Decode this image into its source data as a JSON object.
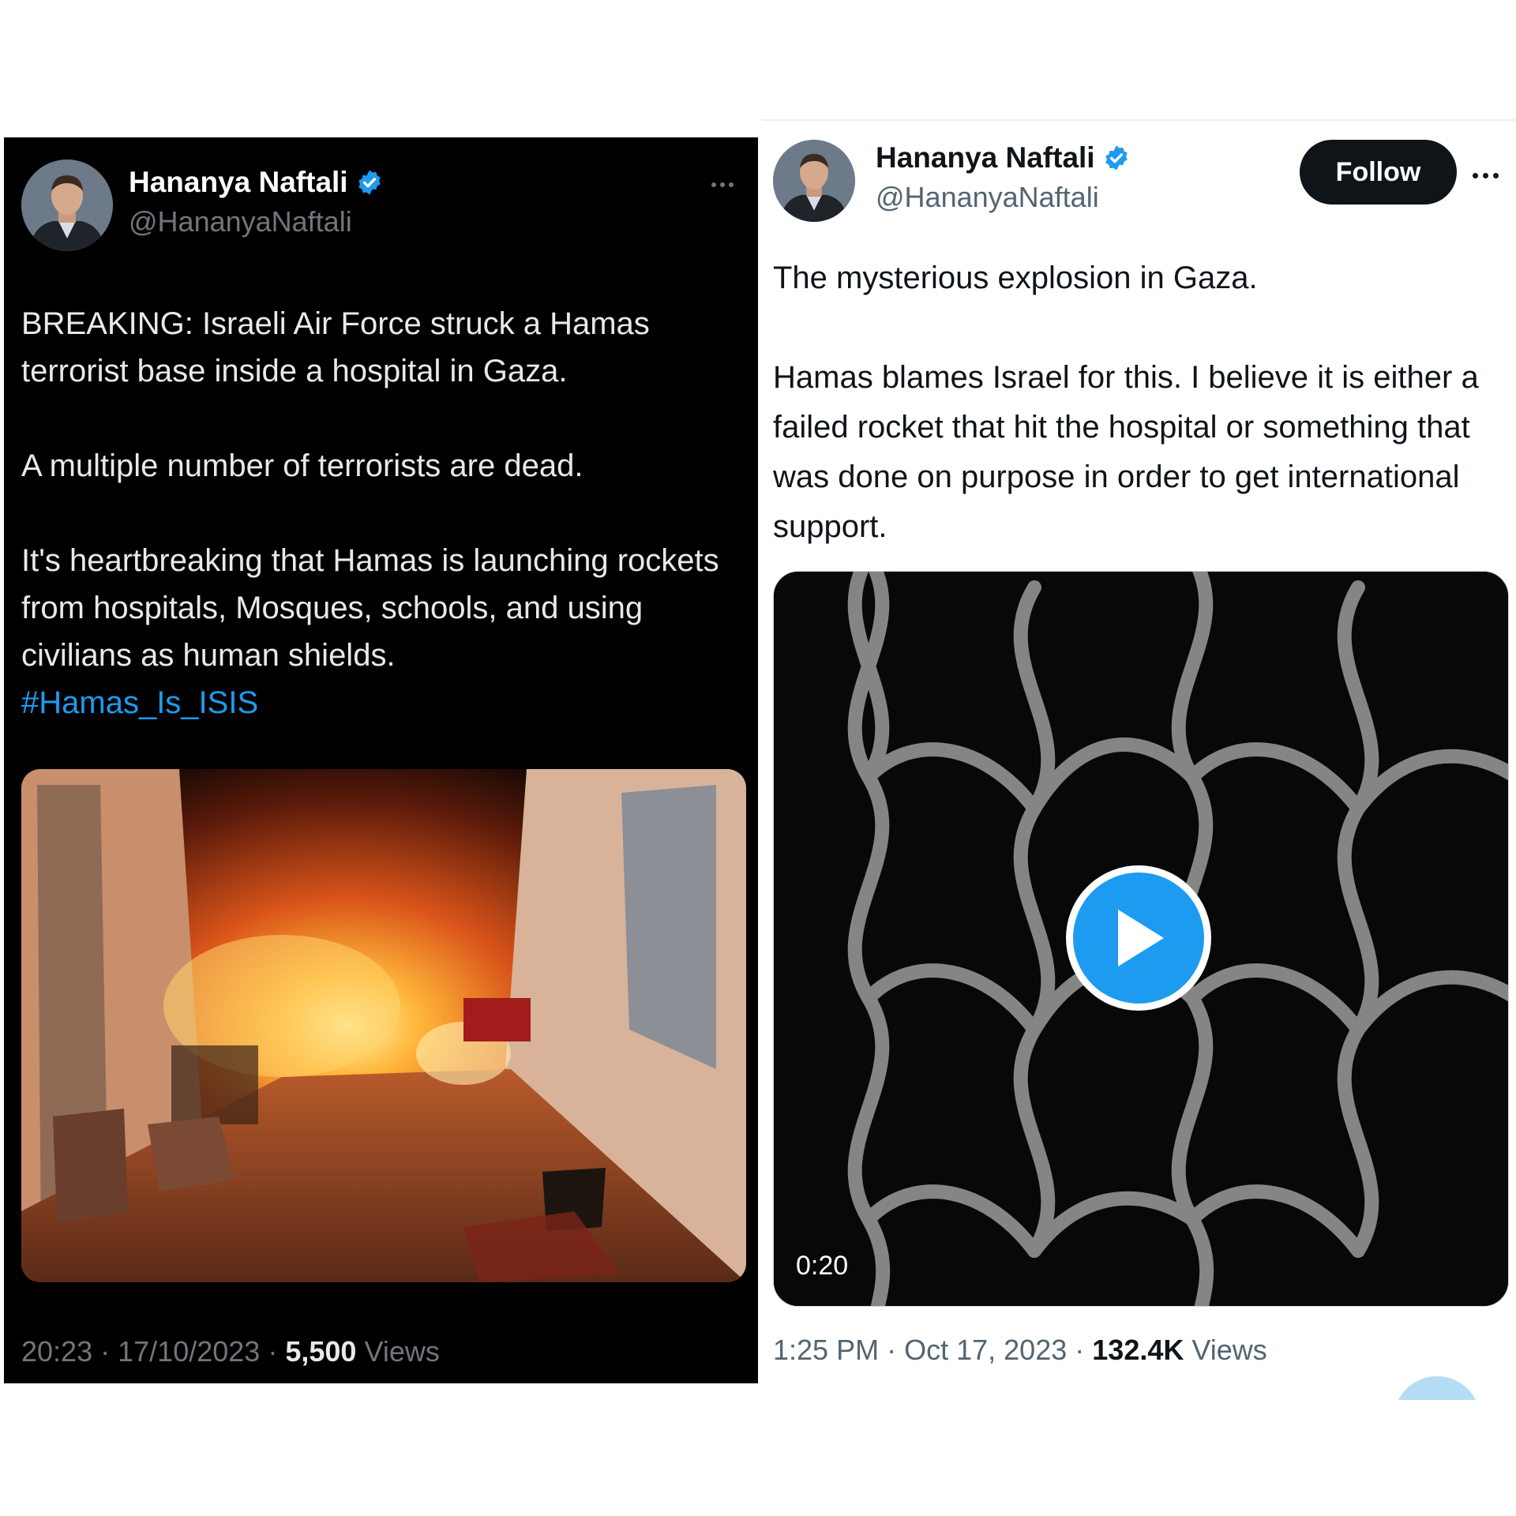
{
  "left_tweet": {
    "theme": "dark",
    "author": {
      "name": "Hananya Naftali",
      "handle": "@HananyaNaftali",
      "verified": true
    },
    "paragraphs": [
      "BREAKING: Israeli Air Force struck a Hamas terrorist base inside a hospital in Gaza.",
      "A multiple number of terrorists are dead.",
      "It's heartbreaking that Hamas is launching rockets from hospitals, Mosques, schools, and using civilians as human shields."
    ],
    "hashtag": "#Hamas_Is_ISIS",
    "media": {
      "kind": "image"
    },
    "meta": {
      "time": "20:23",
      "date": "17/10/2023",
      "views_count": "5,500",
      "views_label": "Views",
      "separator": "·"
    },
    "more_icon": "ellipsis-icon",
    "colors": {
      "background": "#000000",
      "text": "#e7e9ea",
      "secondary": "#71767b",
      "link": "#1d9bf0"
    }
  },
  "right_tweet": {
    "theme": "light",
    "author": {
      "name": "Hananya Naftali",
      "handle": "@HananyaNaftali",
      "verified": true
    },
    "follow_label": "Follow",
    "paragraphs": [
      "The mysterious explosion in Gaza.",
      "Hamas blames Israel for this. I believe it is either a failed rocket that hit the hospital or something that was done on purpose in order to get international support."
    ],
    "media": {
      "kind": "video",
      "duration": "0:20",
      "play_icon": "play-icon"
    },
    "meta": {
      "time": "1:25 PM",
      "date": "Oct 17, 2023",
      "views_count": "132.4K",
      "views_label": "Views",
      "separator": "·"
    },
    "more_icon": "ellipsis-icon",
    "colors": {
      "background": "#ffffff",
      "text": "#0f1419",
      "secondary": "#536471",
      "button": "#0f1419",
      "accent": "#1d9bf0"
    }
  }
}
